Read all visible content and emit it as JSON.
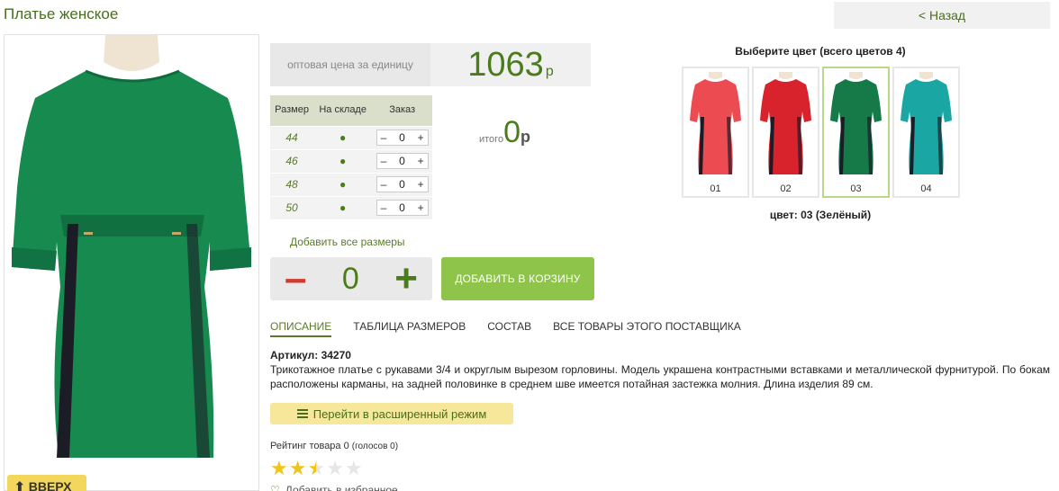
{
  "page": {
    "title": "Платье женское",
    "back_label": "< Назад",
    "up_label": "ВВЕРХ"
  },
  "price": {
    "label": "оптовая цена за единицу",
    "value": "1063",
    "currency": "р"
  },
  "size_table": {
    "headers": [
      "Размер",
      "На складе",
      "Заказ"
    ],
    "rows": [
      {
        "size": "44",
        "in_stock": "●",
        "qty": "0"
      },
      {
        "size": "46",
        "in_stock": "●",
        "qty": "0"
      },
      {
        "size": "48",
        "in_stock": "●",
        "qty": "0"
      },
      {
        "size": "50",
        "in_stock": "●",
        "qty": "0"
      }
    ],
    "minus": "–",
    "plus": "+"
  },
  "total": {
    "label": "итого",
    "value": "0",
    "currency": "р"
  },
  "add_all_sizes": "Добавить все размеры",
  "quantity": {
    "minus": "–",
    "value": "0",
    "plus": "+"
  },
  "cart_button": "ДОБАВИТЬ В КОРЗИНУ",
  "tabs": [
    {
      "label": "ОПИСАНИЕ",
      "active": true
    },
    {
      "label": "ТАБЛИЦА РАЗМЕРОВ",
      "active": false
    },
    {
      "label": "СОСТАВ",
      "active": false
    },
    {
      "label": "ВСЕ ТОВАРЫ ЭТОГО ПОСТАВЩИКА",
      "active": false
    }
  ],
  "product": {
    "sku": "Артикул: 34270",
    "description": "Трикотажное платье с рукавами 3/4 и округлым вырезом горловины. Модель украшена контрастными вставками и металлической фурнитурой. По бокам расположены карманы, на задней половинке в среднем шве имеется потайная застежка молния. Длина изделия 89 см."
  },
  "extended_mode": "Перейти в расширенный режим",
  "rating": {
    "text": "Рейтинг товара 0",
    "votes": "(голосов 0)",
    "stars_filled": 2.5,
    "stars_total": 5
  },
  "favorite": "Добавить в избранное",
  "colors": {
    "title": "Выберите цвет (всего цветов 4)",
    "swatches": [
      {
        "num": "01",
        "color": "#ec4b52"
      },
      {
        "num": "02",
        "color": "#d8232c"
      },
      {
        "num": "03",
        "color": "#157a48"
      },
      {
        "num": "04",
        "color": "#1aa7a3"
      }
    ],
    "selected_index": 2,
    "selected_label": "цвет: 03 (Зелёный)"
  },
  "theme": {
    "dress_color": "#168a4f",
    "accent_green": "#4a7d1a",
    "star_color": "#f0c419"
  }
}
